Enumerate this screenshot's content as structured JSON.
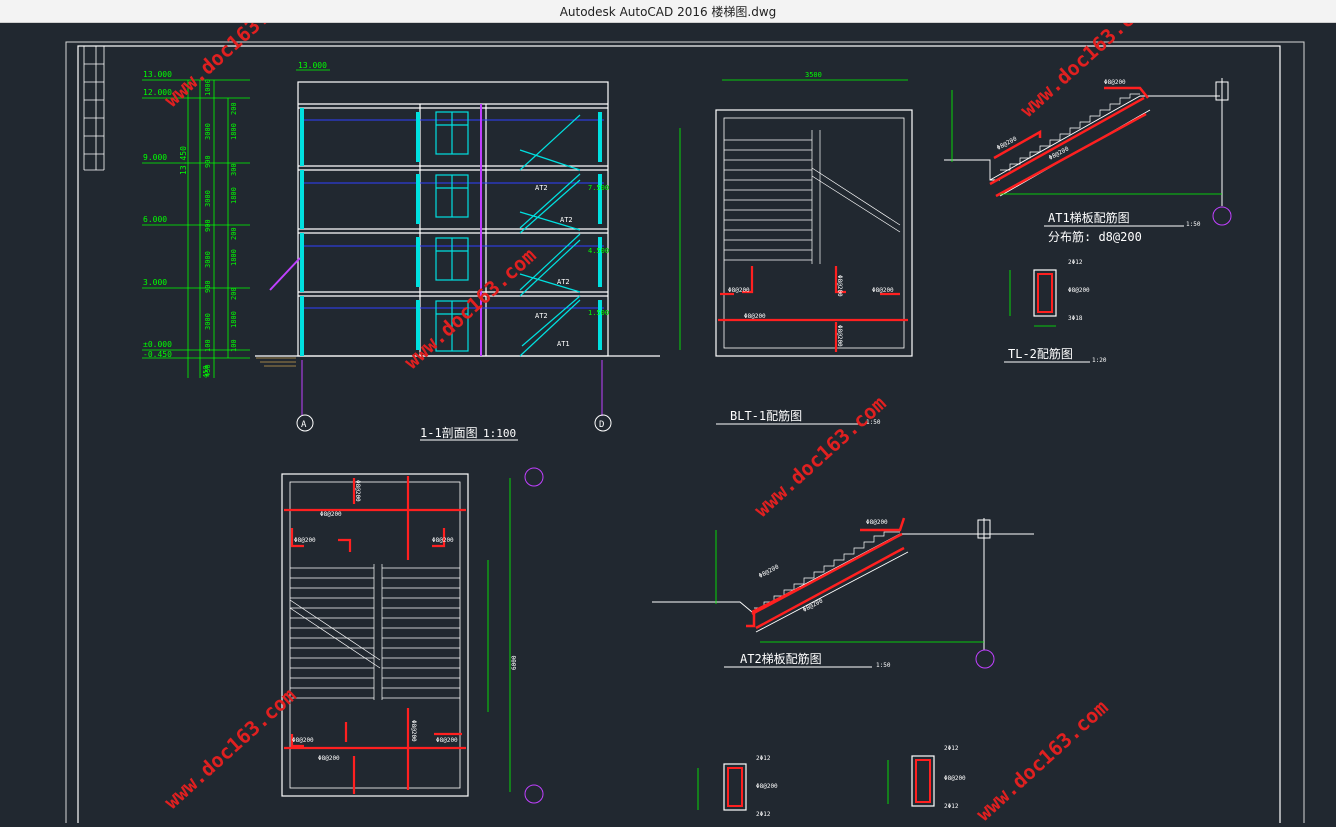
{
  "window": {
    "title": "Autodesk AutoCAD 2016    楼梯图.dwg"
  },
  "colors": {
    "background": "#212830",
    "frame": "#ffffff",
    "dimension": "#00ff00",
    "rebar": "#ff2020",
    "stair": "#00e0e0",
    "slab": "#3040ff",
    "column": "#c040ff",
    "watermark": "#e02020"
  },
  "watermark": "www.doc163.com",
  "section_1_1": {
    "title": "1-1剖面图",
    "scale": "1:100",
    "top_level": "13.000",
    "levels": [
      "13.000",
      "12.000",
      "9.000",
      "6.000",
      "3.000",
      "±0.000",
      "-0.450"
    ],
    "total_height": "13.450",
    "dims_right": [
      "1000",
      "3000",
      "900",
      "3000",
      "900",
      "3000",
      "900",
      "3000",
      "100",
      "450"
    ],
    "dims_inner": [
      "200",
      "1800",
      "300",
      "1800",
      "200",
      "1800",
      "200",
      "1800",
      "100",
      "450"
    ],
    "landing_levels": [
      "7.500",
      "4.500",
      "1.500"
    ],
    "flight_labels": [
      "AT2",
      "AT2",
      "AT2",
      "AT2",
      "AT1"
    ],
    "axes": [
      "A",
      "D"
    ]
  },
  "plan_blt1": {
    "title": "BLT-1配筋图",
    "scale": "1:50",
    "width_dim": "3500",
    "rebar": [
      "Φ8@200",
      "Φ8@200",
      "Φ8@200",
      "Φ8@200",
      "Φ8@200"
    ]
  },
  "at1": {
    "title": "AT1梯板配筋图",
    "scale": "1:50",
    "note": "分布筋: d8@200",
    "rebar": [
      "Φ8@200",
      "Φ8@200",
      "Φ8@200"
    ]
  },
  "tl2": {
    "title": "TL-2配筋图",
    "scale": "1:20",
    "top": "2Φ12",
    "stirrup": "Φ8@200",
    "bottom": "3Φ18"
  },
  "plan_lower": {
    "length_dim": "6000",
    "rebar": [
      "Φ8@200",
      "Φ8@200",
      "Φ8@200",
      "Φ8@200",
      "Φ8@200",
      "Φ8@200",
      "Φ8@200",
      "Φ8@200"
    ]
  },
  "at2": {
    "title": "AT2梯板配筋图",
    "scale": "1:50",
    "rebar": [
      "Φ8@200",
      "Φ8@200",
      "Φ8@200"
    ]
  },
  "beams_bottom": [
    {
      "top": "2Φ12",
      "stirrup": "Φ8@200",
      "bottom": "2Φ12"
    },
    {
      "top": "2Φ12",
      "stirrup": "Φ8@200",
      "bottom": "2Φ12"
    }
  ]
}
